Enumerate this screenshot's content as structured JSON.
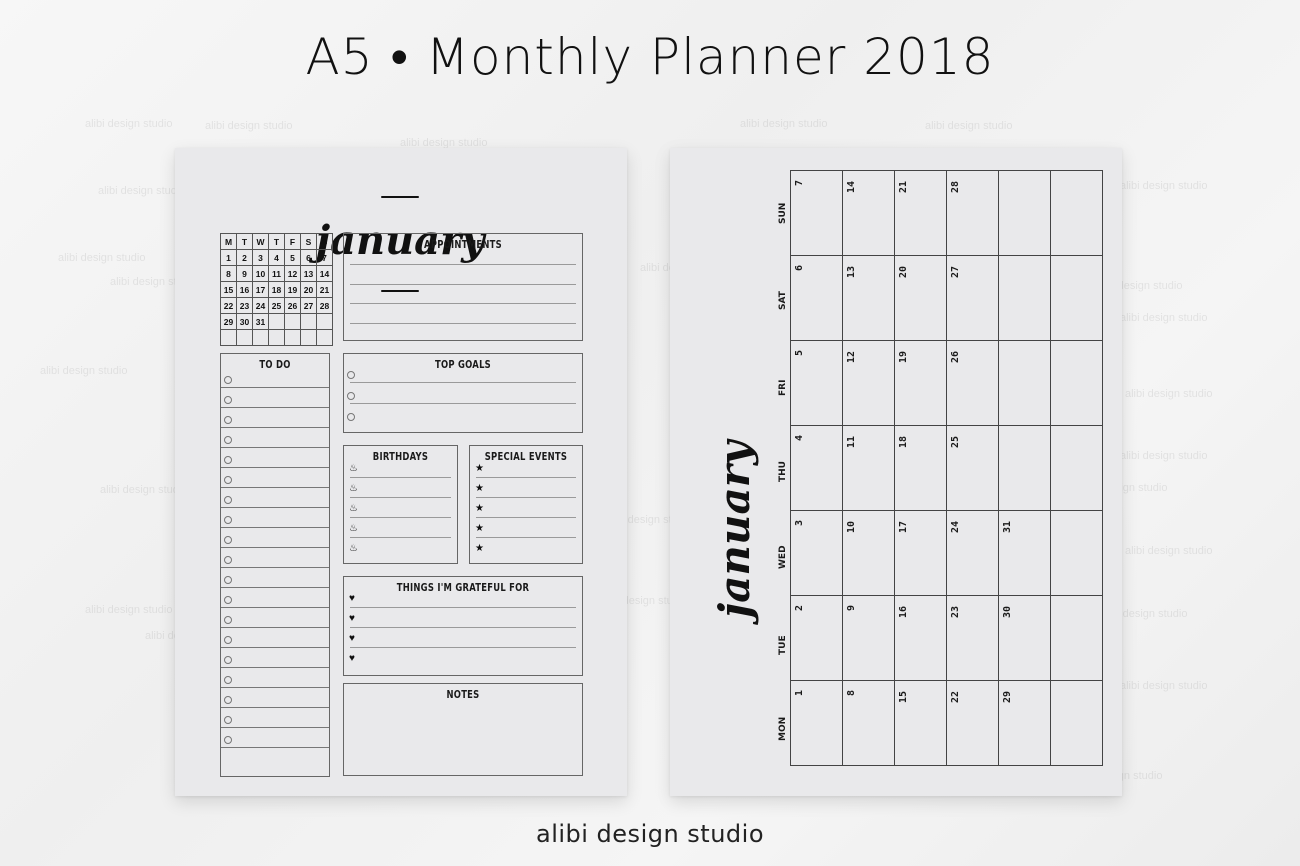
{
  "header": {
    "title": "A5 • Monthly Planner 2018"
  },
  "footer": {
    "brand": "alibi design studio"
  },
  "watermark": "alibi design studio",
  "left_page": {
    "month": "january",
    "mini_calendar": {
      "weekdays": [
        "M",
        "T",
        "W",
        "T",
        "F",
        "S",
        "S"
      ],
      "weeks": [
        [
          "1",
          "2",
          "3",
          "4",
          "5",
          "6",
          "7"
        ],
        [
          "8",
          "9",
          "10",
          "11",
          "12",
          "13",
          "14"
        ],
        [
          "15",
          "16",
          "17",
          "18",
          "19",
          "20",
          "21"
        ],
        [
          "22",
          "23",
          "24",
          "25",
          "26",
          "27",
          "28"
        ],
        [
          "29",
          "30",
          "31",
          "",
          "",
          "",
          ""
        ],
        [
          "",
          "",
          "",
          "",
          "",
          "",
          ""
        ]
      ]
    },
    "sections": {
      "appointments": {
        "title": "APPOINTMENTS",
        "lines": 4
      },
      "todo": {
        "title": "TO DO",
        "items": 19,
        "icon": "circle-icon"
      },
      "top_goals": {
        "title": "TOP GOALS",
        "items": 3,
        "icon": "circle-icon"
      },
      "birthdays": {
        "title": "BIRTHDAYS",
        "items": 5,
        "icon": "cake-icon",
        "glyph": "♨"
      },
      "special_events": {
        "title": "SPECIAL EVENTS",
        "items": 5,
        "icon": "star-icon",
        "glyph": "★"
      },
      "grateful": {
        "title": "THINGS I'M GRATEFUL FOR",
        "items": 4,
        "icon": "heart-icon",
        "glyph": "♥"
      },
      "notes": {
        "title": "NOTES"
      }
    }
  },
  "right_page": {
    "month": "january",
    "days": [
      "SUN",
      "SAT",
      "FRI",
      "THU",
      "WED",
      "TUE",
      "MON"
    ],
    "rows": [
      [
        "7",
        "14",
        "21",
        "28",
        "",
        ""
      ],
      [
        "6",
        "13",
        "20",
        "27",
        "",
        ""
      ],
      [
        "5",
        "12",
        "19",
        "26",
        "",
        ""
      ],
      [
        "4",
        "11",
        "18",
        "25",
        "",
        ""
      ],
      [
        "3",
        "10",
        "17",
        "24",
        "31",
        ""
      ],
      [
        "2",
        "9",
        "16",
        "23",
        "30",
        ""
      ],
      [
        "1",
        "8",
        "15",
        "22",
        "29",
        ""
      ]
    ]
  }
}
